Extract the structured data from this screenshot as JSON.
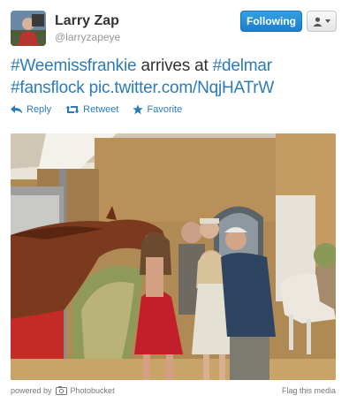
{
  "user": {
    "name": "Larry Zap",
    "handle": "@larryzapeye"
  },
  "header": {
    "follow_label": "Following"
  },
  "tweet": {
    "hashtag1": "#Weemissfrankie",
    "text1": " arrives at ",
    "hashtag2": "#delmar",
    "hashtag3": "#fansflock",
    "link": "pic.twitter.com/NqjHATrW"
  },
  "actions": {
    "reply": "Reply",
    "retweet": "Retweet",
    "favorite": "Favorite"
  },
  "footer": {
    "powered_by": "powered by",
    "service": "Photobucket",
    "flag": "Flag this media"
  },
  "colors": {
    "link": "#2b7bb9",
    "follow_button": "#1d7fcf"
  }
}
